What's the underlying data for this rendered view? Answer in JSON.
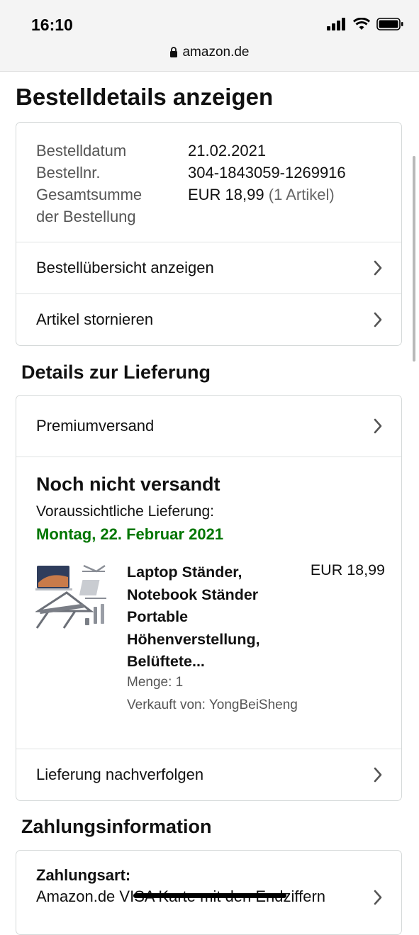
{
  "status_bar": {
    "time": "16:10"
  },
  "browser": {
    "url": "amazon.de"
  },
  "page": {
    "title": "Bestelldetails anzeigen"
  },
  "order": {
    "date_label": "Bestelldatum",
    "date_value": "21.02.2021",
    "number_label": "Bestellnr.",
    "number_value": "304-1843059-1269916",
    "total_label_line1": "Gesamtsumme",
    "total_label_line2": "der Bestellung",
    "total_value": "EUR 18,99",
    "total_items": "(1 Artikel)",
    "links": {
      "overview": "Bestellübersicht anzeigen",
      "cancel": "Artikel stornieren"
    }
  },
  "delivery": {
    "section_title": "Details zur Lieferung",
    "shipping_method": "Premiumversand",
    "status": "Noch nicht versandt",
    "estimate_label": "Voraussichtliche Lieferung:",
    "estimate_date": "Montag, 22. Februar 2021",
    "product": {
      "title": "Laptop Ständer, Notebook Ständer Portable Höhenverstellung, Belüftete...",
      "price": "EUR 18,99",
      "quantity": "Menge: 1",
      "seller": "Verkauft von: YongBeiSheng"
    },
    "track_link": "Lieferung nachverfolgen"
  },
  "payment": {
    "section_title": "Zahlungsinformation",
    "method_label": "Zahlungsart:",
    "method_text": "Amazon.de VISA Karte mit den Endziffern"
  },
  "colors": {
    "delivery_date": "#007600",
    "border": "#d5d9d9",
    "status_bar_bg": "#f4f4f4"
  },
  "icons": [
    "lock-icon",
    "signal-icon",
    "wifi-icon",
    "battery-icon",
    "chevron-right-icon",
    "product-image"
  ]
}
